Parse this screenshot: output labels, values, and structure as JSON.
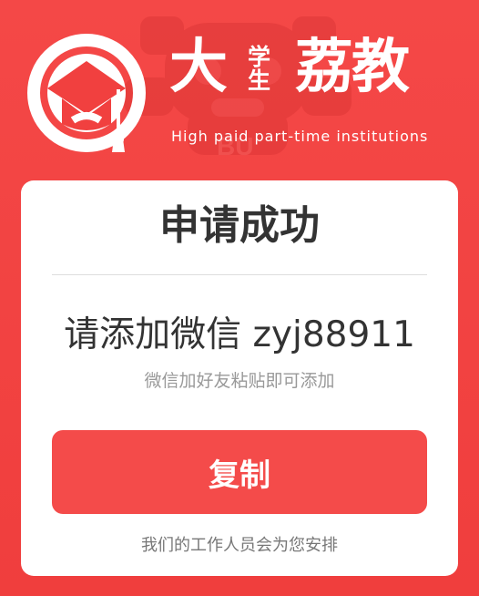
{
  "brand": {
    "title_main": "大",
    "title_small": "学\n生",
    "title_rest": "荔教",
    "subtitle": "High paid part-time institutions",
    "mascot_text": "BU"
  },
  "card": {
    "title": "申请成功",
    "wechat_line": "请添加微信 zyj88911",
    "hint": "微信加好友粘贴即可添加",
    "copy_label": "复制",
    "note": "我们的工作人员会为您安排"
  },
  "colors": {
    "background": "#f1403f",
    "button": "#f44b4a",
    "white": "#ffffff",
    "text": "#333333",
    "muted": "#999999"
  },
  "icons": {
    "logo": "graduation-cap-icon",
    "mascot": "tiger-mascot-icon"
  }
}
